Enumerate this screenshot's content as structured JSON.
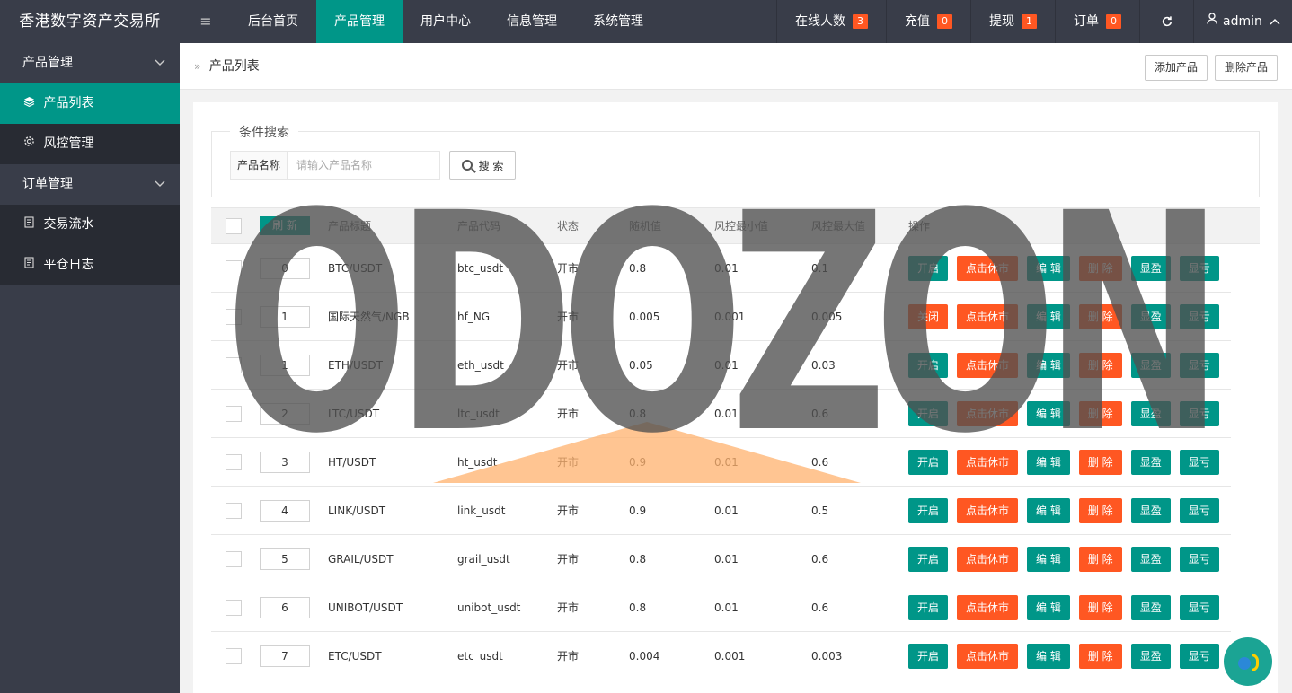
{
  "brand": "香港数字资产交易所",
  "menu_icon": "≡",
  "nav_main": [
    "后台首页",
    "产品管理",
    "用户中心",
    "信息管理",
    "系统管理"
  ],
  "nav_main_active": 1,
  "nav_right": {
    "online": {
      "label": "在线人数",
      "count": "3"
    },
    "recharge": {
      "label": "充值",
      "count": "0"
    },
    "withdraw": {
      "label": "提现",
      "count": "1"
    },
    "orders": {
      "label": "订单",
      "count": "0"
    },
    "refresh_icon": "refresh-icon",
    "user": "admin"
  },
  "sidebar": {
    "groups": [
      {
        "label": "产品管理",
        "items": [
          {
            "label": "产品列表",
            "icon": "layers-icon",
            "active": true
          },
          {
            "label": "风控管理",
            "icon": "gear-icon",
            "active": false
          }
        ]
      },
      {
        "label": "订单管理",
        "items": [
          {
            "label": "交易流水",
            "icon": "document-icon",
            "active": false
          },
          {
            "label": "平仓日志",
            "icon": "document-icon",
            "active": false
          }
        ]
      }
    ]
  },
  "breadcrumb": "产品列表",
  "toolbar": {
    "add": "添加产品",
    "delete": "删除产品"
  },
  "search": {
    "legend": "条件搜索",
    "label": "产品名称",
    "placeholder": "请输入产品名称",
    "button": "搜 索"
  },
  "table": {
    "refresh_label": "刷 新",
    "headers": [
      "产品标题",
      "产品代码",
      "状态",
      "随机值",
      "风控最小值",
      "风控最大值",
      "操作"
    ],
    "rows": [
      {
        "order": "0",
        "title": "BTC/USDT",
        "code": "btc_usdt",
        "status": "开市",
        "random": "0.8",
        "min": "0.01",
        "max": "0.1",
        "toggle": "开启",
        "toggle_color": "green"
      },
      {
        "order": "1",
        "title": "国际天然气/NGB",
        "code": "hf_NG",
        "status": "开市",
        "random": "0.005",
        "min": "0.001",
        "max": "0.005",
        "toggle": "关闭",
        "toggle_color": "orange"
      },
      {
        "order": "1",
        "title": "ETH/USDT",
        "code": "eth_usdt",
        "status": "开市",
        "random": "0.05",
        "min": "0.01",
        "max": "0.03",
        "toggle": "开启",
        "toggle_color": "green"
      },
      {
        "order": "2",
        "title": "LTC/USDT",
        "code": "ltc_usdt",
        "status": "开市",
        "random": "0.8",
        "min": "0.01",
        "max": "0.6",
        "toggle": "开启",
        "toggle_color": "green"
      },
      {
        "order": "3",
        "title": "HT/USDT",
        "code": "ht_usdt",
        "status": "开市",
        "random": "0.9",
        "min": "0.01",
        "max": "0.6",
        "toggle": "开启",
        "toggle_color": "green"
      },
      {
        "order": "4",
        "title": "LINK/USDT",
        "code": "link_usdt",
        "status": "开市",
        "random": "0.9",
        "min": "0.01",
        "max": "0.5",
        "toggle": "开启",
        "toggle_color": "green"
      },
      {
        "order": "5",
        "title": "GRAIL/USDT",
        "code": "grail_usdt",
        "status": "开市",
        "random": "0.8",
        "min": "0.01",
        "max": "0.6",
        "toggle": "开启",
        "toggle_color": "green"
      },
      {
        "order": "6",
        "title": "UNIBOT/USDT",
        "code": "unibot_usdt",
        "status": "开市",
        "random": "0.8",
        "min": "0.01",
        "max": "0.6",
        "toggle": "开启",
        "toggle_color": "green"
      },
      {
        "order": "7",
        "title": "ETC/USDT",
        "code": "etc_usdt",
        "status": "开市",
        "random": "0.004",
        "min": "0.001",
        "max": "0.003",
        "toggle": "开启",
        "toggle_color": "green"
      }
    ],
    "actions": {
      "close_market": "点击休市",
      "edit": "编 辑",
      "delete": "删 除",
      "profit": "显盈",
      "loss": "显亏"
    }
  },
  "watermark": "ODOZON",
  "colors": {
    "primary": "#009688",
    "danger": "#ff5722",
    "topbar": "#393d49",
    "sidebar_sub": "#282b33",
    "badge": "#ff5722"
  }
}
